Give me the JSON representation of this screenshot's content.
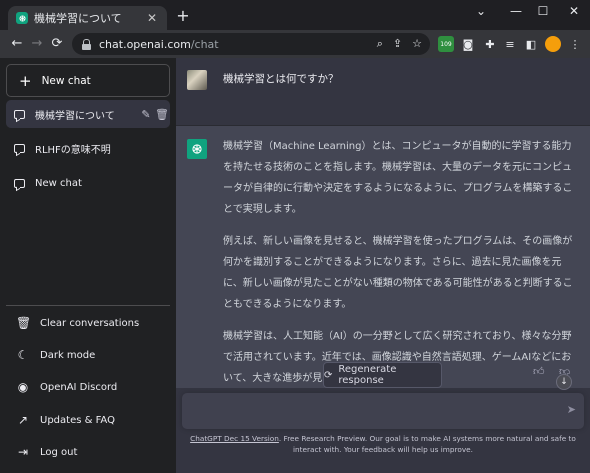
{
  "browser": {
    "tab_title": "機械学習について",
    "tab_close": "✕",
    "new_tab": "+",
    "window_controls": [
      "⌄",
      "—",
      "☐",
      "✕"
    ],
    "back": "←",
    "forward": "→",
    "reload": "⟳",
    "url_host": "chat.openai.com",
    "url_path": "/chat",
    "extension_badge": "109"
  },
  "sidebar": {
    "new_chat_label": "New chat",
    "conversations": [
      {
        "label": "機械学習について"
      },
      {
        "label": "RLHFの意味不明"
      },
      {
        "label": "New chat"
      }
    ],
    "bottom_items": [
      {
        "label": "Clear conversations",
        "icon": "trash-icon"
      },
      {
        "label": "Dark mode",
        "icon": "moon-icon"
      },
      {
        "label": "OpenAI Discord",
        "icon": "discord-icon"
      },
      {
        "label": "Updates & FAQ",
        "icon": "external-link-icon"
      },
      {
        "label": "Log out",
        "icon": "logout-icon"
      }
    ]
  },
  "chat": {
    "user_message": "機械学習とは何ですか？",
    "bot_paragraphs": [
      "機械学習（Machine Learning）とは、コンピュータが自動的に学習する能力を持たせる技術のことを指します。機械学習は、大量のデータを元にコンピュータが自律的に行動や決定をするようになるように、プログラムを構築することで実現します。",
      "例えば、新しい画像を見せると、機械学習を使ったプログラムは、その画像が何かを識別することができるようになります。さらに、過去に見た画像を元に、新しい画像が見たことがない種類の物体である可能性があると判断することもできるようになります。",
      "機械学習は、人工知能（AI）の一分野として広く研究されており、様々な分野で活用されています。近年では、画像認識や自然言語処理、ゲームAIなどにおいて、大きな進歩が見られます。"
    ],
    "regenerate_label": "Regenerate response",
    "input_placeholder": "",
    "footer_link": "ChatGPT Dec 15 Version",
    "footer_text": ". Free Research Preview. Our goal is to make AI systems more natural and safe to interact with. Your feedback will help us improve."
  },
  "colors": {
    "sidebar_bg": "#202123",
    "main_bg": "#343541",
    "bot_bg": "#444654",
    "accent": "#10a37f"
  }
}
